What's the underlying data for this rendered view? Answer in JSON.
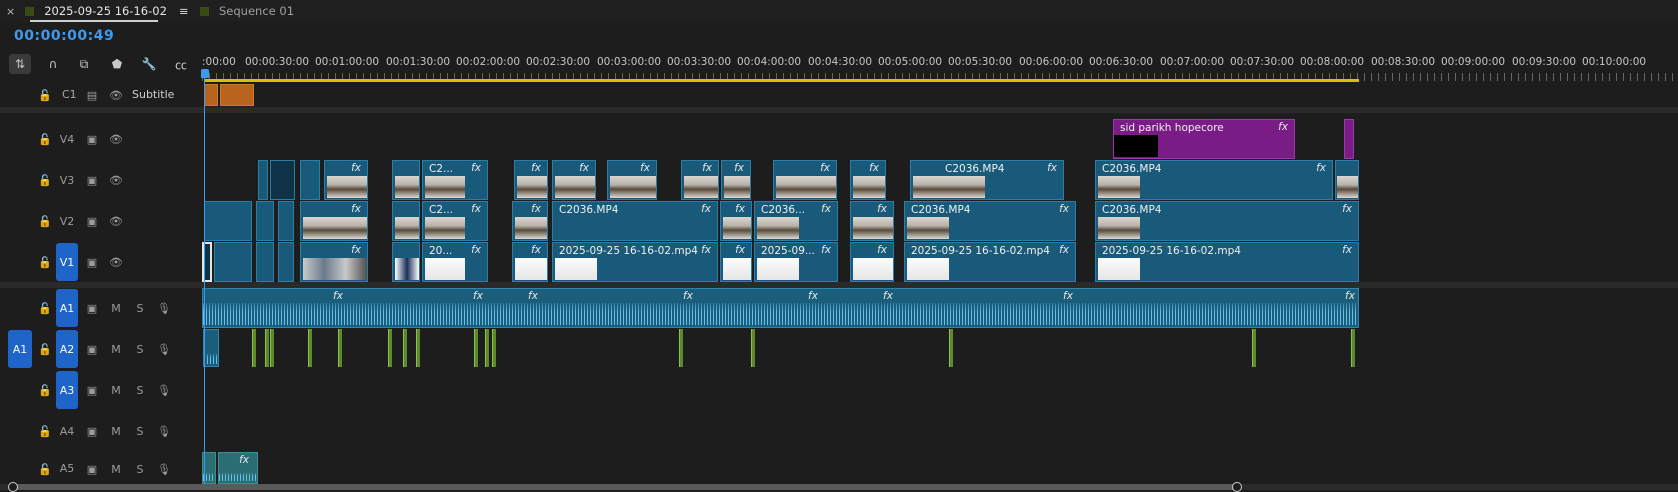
{
  "tabs": [
    {
      "label": "2025-09-25 16-16-02",
      "close": "×",
      "menu": "≡"
    },
    {
      "label": "Sequence 01"
    }
  ],
  "timecode": "00:00:00:49",
  "ruler": {
    "labels": [
      ":00:00",
      "00:00:30:00",
      "00:01:00:00",
      "00:01:30:00",
      "00:02:00:00",
      "00:02:30:00",
      "00:03:00:00",
      "00:03:30:00",
      "00:04:00:00",
      "00:04:30:00",
      "00:05:00:00",
      "00:05:30:00",
      "00:06:00:00",
      "00:06:30:00",
      "00:07:00:00",
      "00:07:30:00",
      "00:08:00:00",
      "00:08:30:00",
      "00:09:00:00",
      "00:09:30:00",
      "00:10:00:00"
    ]
  },
  "tracks": {
    "c1": {
      "name": "C1",
      "label": "Subtitle"
    },
    "v4": {
      "name": "V4"
    },
    "v3": {
      "name": "V3"
    },
    "v2": {
      "name": "V2"
    },
    "v1": {
      "name": "V1"
    },
    "a1": {
      "name": "A1"
    },
    "a2": {
      "name": "A2"
    },
    "a3": {
      "name": "A3"
    },
    "a4": {
      "name": "A4"
    },
    "a5": {
      "name": "A5"
    },
    "source_patch": "A1",
    "mute": "M",
    "solo": "S"
  },
  "clips": {
    "v4_title": "sid parikh  hopecore",
    "c2_short": "C2...",
    "c2036": "C2036.MP4",
    "c2036_short": "C2036...",
    "file20": "20...",
    "file_full": "2025-09-25 16-16-02.mp4",
    "file_short": "2025-09...",
    "fx": "fx"
  },
  "colors": {
    "accent": "#3d9af0",
    "video_clip": "#195a7a",
    "title_clip": "#7a1c86",
    "subtitle_clip": "#b9641e",
    "work_area": "#d8c200"
  }
}
